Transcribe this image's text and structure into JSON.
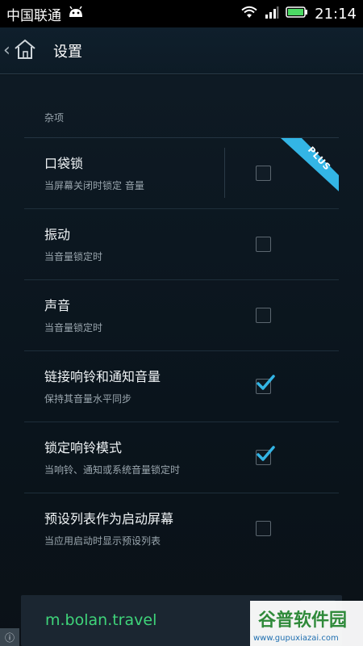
{
  "status_bar": {
    "carrier": "中国联通",
    "time": "21:14"
  },
  "app_bar": {
    "title": "设置"
  },
  "section": {
    "header": "杂项"
  },
  "rows": [
    {
      "title": "口袋锁",
      "subtitle": "当屏幕关闭时锁定 音量",
      "checked": false,
      "badge": "PLUS"
    },
    {
      "title": "振动",
      "subtitle": "当音量锁定时",
      "checked": false
    },
    {
      "title": "声音",
      "subtitle": "当音量锁定时",
      "checked": false
    },
    {
      "title": "链接响铃和通知音量",
      "subtitle": "保持其音量水平同步",
      "checked": true
    },
    {
      "title": "锁定响铃模式",
      "subtitle": "当响铃、通知或系统音量锁定时",
      "checked": true
    },
    {
      "title": "预设列表作为启动屏幕",
      "subtitle": "当应用启动时显示预设列表",
      "checked": false
    }
  ],
  "ad": {
    "text": "m.bolan.travel",
    "info_glyph": "ⓘ"
  },
  "watermark": {
    "title": "谷普软件园",
    "url": "www.gupuxiazai.com"
  },
  "colors": {
    "accent": "#33b5e5",
    "ad_text": "#3fd47a",
    "background": "#0a121a"
  }
}
